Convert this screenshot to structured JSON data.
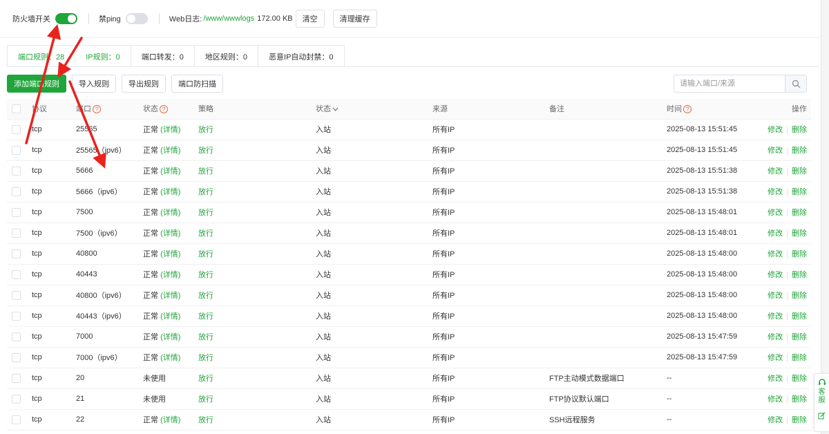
{
  "topbar": {
    "firewall_label": "防火墙开关",
    "firewall_on": true,
    "noping_label": "禁ping",
    "noping_on": false,
    "weblog_label": "Web日志:",
    "weblog_path": "/www/wwwlogs",
    "weblog_size": "172.00 KB",
    "clear_label": "清空",
    "clear_cache_label": "清理缓存"
  },
  "tabs": [
    {
      "label": "端口规则：28",
      "active": true
    },
    {
      "label": "IP规则：0",
      "active": false
    },
    {
      "label": "端口转发：0",
      "active": false
    },
    {
      "label": "地区规则：0",
      "active": false
    },
    {
      "label": "恶意IP自动封禁：0",
      "active": false
    }
  ],
  "toolbar": {
    "add_label": "添加端口规则",
    "import_label": "导入规则",
    "export_label": "导出规则",
    "scan_label": "端口防扫描"
  },
  "search": {
    "placeholder": "请输入端口/来源"
  },
  "table": {
    "headers": {
      "protocol": "协议",
      "port": "端口",
      "status": "状态",
      "policy": "策略",
      "direction": "状态",
      "source": "来源",
      "remark": "备注",
      "time": "时间",
      "action": "操作"
    },
    "rows": [
      {
        "protocol": "tcp",
        "port": "25565",
        "status": "正常",
        "detail": "(详情)",
        "policy": "放行",
        "direction": "入站",
        "source": "所有IP",
        "remark": "",
        "time": "2025-08-13 15:51:45"
      },
      {
        "protocol": "tcp",
        "port": "25565（ipv6）",
        "status": "正常",
        "detail": "(详情)",
        "policy": "放行",
        "direction": "入站",
        "source": "所有IP",
        "remark": "",
        "time": "2025-08-13 15:51:45"
      },
      {
        "protocol": "tcp",
        "port": "5666",
        "status": "正常",
        "detail": "(详情)",
        "policy": "放行",
        "direction": "入站",
        "source": "所有IP",
        "remark": "",
        "time": "2025-08-13 15:51:38"
      },
      {
        "protocol": "tcp",
        "port": "5666（ipv6）",
        "status": "正常",
        "detail": "(详情)",
        "policy": "放行",
        "direction": "入站",
        "source": "所有IP",
        "remark": "",
        "time": "2025-08-13 15:51:38"
      },
      {
        "protocol": "tcp",
        "port": "7500",
        "status": "正常",
        "detail": "(详情)",
        "policy": "放行",
        "direction": "入站",
        "source": "所有IP",
        "remark": "",
        "time": "2025-08-13 15:48:01"
      },
      {
        "protocol": "tcp",
        "port": "7500（ipv6）",
        "status": "正常",
        "detail": "(详情)",
        "policy": "放行",
        "direction": "入站",
        "source": "所有IP",
        "remark": "",
        "time": "2025-08-13 15:48:01"
      },
      {
        "protocol": "tcp",
        "port": "40800",
        "status": "正常",
        "detail": "(详情)",
        "policy": "放行",
        "direction": "入站",
        "source": "所有IP",
        "remark": "",
        "time": "2025-08-13 15:48:00"
      },
      {
        "protocol": "tcp",
        "port": "40443",
        "status": "正常",
        "detail": "(详情)",
        "policy": "放行",
        "direction": "入站",
        "source": "所有IP",
        "remark": "",
        "time": "2025-08-13 15:48:00"
      },
      {
        "protocol": "tcp",
        "port": "40800（ipv6）",
        "status": "正常",
        "detail": "(详情)",
        "policy": "放行",
        "direction": "入站",
        "source": "所有IP",
        "remark": "",
        "time": "2025-08-13 15:48:00"
      },
      {
        "protocol": "tcp",
        "port": "40443（ipv6）",
        "status": "正常",
        "detail": "(详情)",
        "policy": "放行",
        "direction": "入站",
        "source": "所有IP",
        "remark": "",
        "time": "2025-08-13 15:48:00"
      },
      {
        "protocol": "tcp",
        "port": "7000",
        "status": "正常",
        "detail": "(详情)",
        "policy": "放行",
        "direction": "入站",
        "source": "所有IP",
        "remark": "",
        "time": "2025-08-13 15:47:59"
      },
      {
        "protocol": "tcp",
        "port": "7000（ipv6）",
        "status": "正常",
        "detail": "(详情)",
        "policy": "放行",
        "direction": "入站",
        "source": "所有IP",
        "remark": "",
        "time": "2025-08-13 15:47:59"
      },
      {
        "protocol": "tcp",
        "port": "20",
        "status": "未使用",
        "detail": "",
        "policy": "放行",
        "direction": "入站",
        "source": "所有IP",
        "remark": "FTP主动模式数据端口",
        "time": "--"
      },
      {
        "protocol": "tcp",
        "port": "21",
        "status": "未使用",
        "detail": "",
        "policy": "放行",
        "direction": "入站",
        "source": "所有IP",
        "remark": "FTP协议默认端口",
        "time": "--"
      },
      {
        "protocol": "tcp",
        "port": "22",
        "status": "正常",
        "detail": "(详情)",
        "policy": "放行",
        "direction": "入站",
        "source": "所有IP",
        "remark": "SSH远程服务",
        "time": "--"
      }
    ],
    "edit_label": "修改",
    "delete_label": "删除",
    "help_glyph": "?"
  },
  "side_widget": {
    "label": "客服"
  },
  "colors": {
    "accent": "#20a53a",
    "annotation_arrow": "#e8231e",
    "help_icon": "#e56c3f"
  },
  "icons": [
    "search-icon",
    "help-icon",
    "chevron-down-icon",
    "headset-icon",
    "edit-icon"
  ]
}
